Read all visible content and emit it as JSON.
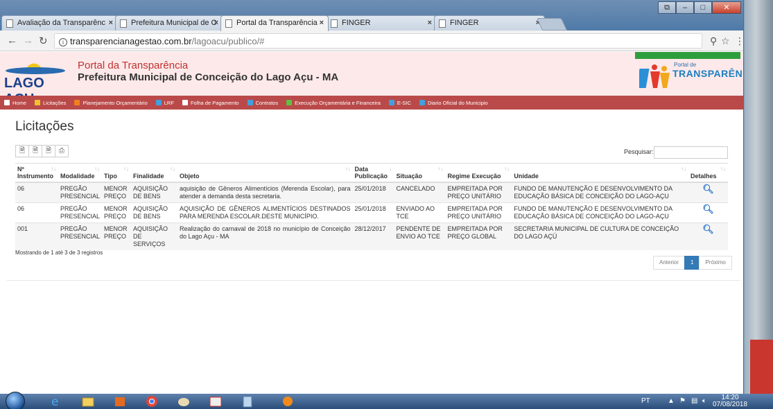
{
  "browser": {
    "tabs": [
      {
        "label": "Avaliação da Transparênc",
        "active": false
      },
      {
        "label": "Prefeitura Municipal de C",
        "active": false
      },
      {
        "label": "Portal da Transparência",
        "active": true
      },
      {
        "label": "FINGER",
        "active": false
      },
      {
        "label": "FINGER",
        "active": false
      }
    ],
    "url_host": "transparencianagestao.com.br",
    "url_path": "/lagoacu/publico/#"
  },
  "header": {
    "logo_text": "LAGO AÇU",
    "portal_title": "Portal da Transparência",
    "prefeitura_title": "Prefeitura Municipal de Conceição do Lago Açu - MA",
    "transp_small": "Portal de",
    "transp_big": "TRANSPARÊNCIA"
  },
  "menu": [
    {
      "label": "Home",
      "icon": "home-icon",
      "color": "#ffffff"
    },
    {
      "label": "Licitações",
      "icon": "gavel-icon",
      "color": "#f0c030"
    },
    {
      "label": "Planejamento Orçamentário",
      "icon": "chart-icon",
      "color": "#f08020"
    },
    {
      "label": "LRF",
      "icon": "document-icon",
      "color": "#40a0e0"
    },
    {
      "label": "Folha de Pagamento",
      "icon": "payroll-icon",
      "color": "#ffffff"
    },
    {
      "label": "Contratos",
      "icon": "contract-icon",
      "color": "#40a0e0"
    },
    {
      "label": "Execução Orçamentária e Financeira",
      "icon": "money-icon",
      "color": "#60c040"
    },
    {
      "label": "E-SIC",
      "icon": "info-icon",
      "color": "#40a0e0"
    },
    {
      "label": "Diario Oficial do Municipio",
      "icon": "newspaper-icon",
      "color": "#40a0e0"
    }
  ],
  "content": {
    "title": "Licitações",
    "search_label": "Pesquisar:",
    "info": "Mostrando de 1 até 3 de 3 registros",
    "pager": {
      "prev": "Anterior",
      "current": "1",
      "next": "Próximo"
    }
  },
  "table": {
    "headers": [
      "Nº Instrumento",
      "Modalidade",
      "Tipo",
      "Finalidade",
      "Objeto",
      "Data Publicação",
      "Situação",
      "Regime Execução",
      "Unidade",
      "Detalhes"
    ],
    "rows": [
      {
        "instrumento": "06",
        "modalidade": "PREGÃO PRESENCIAL",
        "tipo": "MENOR PREÇO",
        "finalidade": "AQUISIÇÃO DE BENS",
        "objeto": "aquisição de Gêneros Alimentícios (Merenda Escolar), para atender a demanda desta secretaria.",
        "data": "25/01/2018",
        "situacao": "CANCELADO",
        "regime": "EMPREITADA POR PREÇO UNITÁRIO",
        "unidade": "FUNDO DE MANUTENÇÃO E DESENVOLVIMENTO DA EDUCAÇÃO BÁSICA DE CONCEIÇÃO DO LAGO-AÇU"
      },
      {
        "instrumento": "06",
        "modalidade": "PREGÃO PRESENCIAL",
        "tipo": "MENOR PREÇO",
        "finalidade": "AQUISIÇÃO DE BENS",
        "objeto": "AQUISIÇÃO DE GÊNEROS ALIMENTÍCIOS DESTINADOS PARA MERENDA ESCOLAR.DESTE MUNICÍPIO.",
        "data": "25/01/2018",
        "situacao": "ENVIADO AO TCE",
        "regime": "EMPREITADA POR PREÇO UNITÁRIO",
        "unidade": "FUNDO DE MANUTENÇÃO E DESENVOLVIMENTO DA EDUCAÇÃO BÁSICA DE CONCEIÇÃO DO LAGO-AÇU"
      },
      {
        "instrumento": "001",
        "modalidade": "PREGÃO PRESENCIAL",
        "tipo": "MENOR PREÇO",
        "finalidade": "AQUISIÇÃO DE SERVIÇOS",
        "objeto": "Realização do carnaval de 2018 no município de Conceição do Lago Açu - MA",
        "data": "28/12/2017",
        "situacao": "PENDENTE DE ENVIO AO TCE",
        "regime": "EMPREITADA POR PREÇO GLOBAL",
        "unidade": "SECRETARIA MUNICIPAL DE CULTURA DE CONCEIÇÃO DO LAGO AÇÚ"
      }
    ]
  },
  "taskbar": {
    "lang": "PT",
    "time": "14:20",
    "date": "07/08/2018"
  }
}
